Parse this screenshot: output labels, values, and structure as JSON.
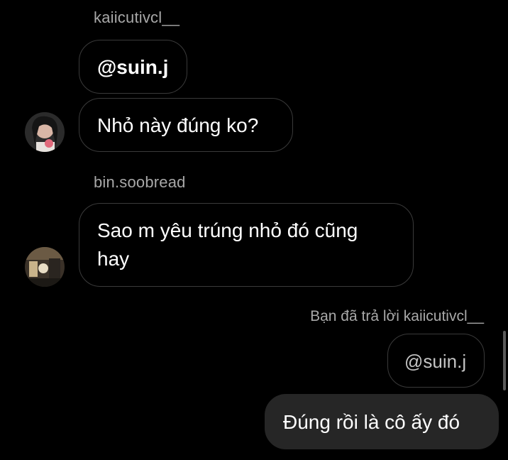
{
  "thread": {
    "group1": {
      "sender": "kaiicutivcl__",
      "mention": "@suin.j",
      "message": "Nhỏ này đúng ko?"
    },
    "group2": {
      "sender": "bin.soobread",
      "message_line1": "Sao m yêu trúng nhỏ đó cũng",
      "message_line2": "hay"
    },
    "outgoing": {
      "reply_status": "Bạn đã trả lời kaiicutivcl__",
      "quoted": "@suin.j",
      "message": "Đúng rồi là cô ấy đó"
    }
  },
  "colors": {
    "background": "#000000",
    "bubble_border": "#3a3a3a",
    "outgoing_bubble": "#262626",
    "secondary_text": "#a8a8a8"
  }
}
